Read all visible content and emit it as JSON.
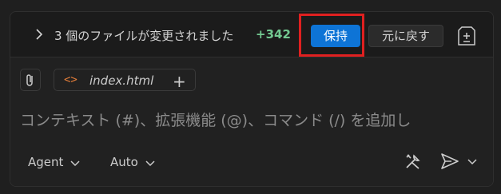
{
  "changes": {
    "summary": "3 個のファイルが変更されました",
    "added_lines": "+342",
    "keep_label": "保持",
    "undo_label": "元に戻す"
  },
  "context": {
    "file_name": "index.html",
    "file_icon": "<>",
    "add_icon": "+"
  },
  "prompt": {
    "placeholder": "コンテキスト (#)、拡張機能 (@)、コマンド (/) を追加し"
  },
  "toolbar": {
    "mode_label": "Agent",
    "model_label": "Auto"
  },
  "colors": {
    "accent": "#0e74d6",
    "added": "#73c991",
    "highlight": "#e02020",
    "file_icon": "#e57e3a"
  },
  "icons": [
    "chevron-right-icon",
    "review-icon",
    "paperclip-icon",
    "code-icon",
    "plus-icon",
    "chevron-down-icon",
    "tools-icon",
    "send-icon"
  ]
}
